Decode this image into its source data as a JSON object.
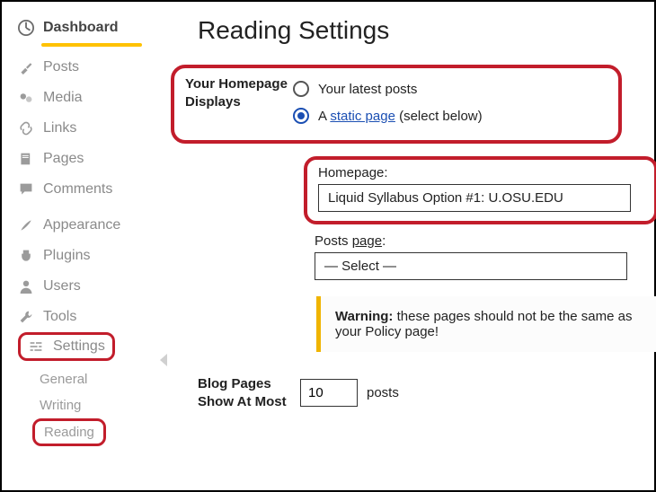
{
  "sidebar": {
    "items": [
      {
        "label": "Dashboard",
        "icon": "dashboard-icon",
        "active": true
      },
      {
        "label": "Posts",
        "icon": "pin-icon"
      },
      {
        "label": "Media",
        "icon": "media-icon"
      },
      {
        "label": "Links",
        "icon": "link-icon"
      },
      {
        "label": "Pages",
        "icon": "page-icon"
      },
      {
        "label": "Comments",
        "icon": "comment-icon"
      },
      {
        "label": "Appearance",
        "icon": "brush-icon"
      },
      {
        "label": "Plugins",
        "icon": "plug-icon"
      },
      {
        "label": "Users",
        "icon": "user-icon"
      },
      {
        "label": "Tools",
        "icon": "wrench-icon"
      },
      {
        "label": "Settings",
        "icon": "settings-icon",
        "highlighted": true
      }
    ],
    "sub_items": [
      {
        "label": "General"
      },
      {
        "label": "Writing"
      },
      {
        "label": "Reading",
        "highlighted": true
      }
    ]
  },
  "page": {
    "title": "Reading Settings",
    "homepage_section_label": "Your Homepage Displays",
    "radio_latest": "Your latest posts",
    "radio_static_prefix": "A ",
    "radio_static_link": "static page",
    "radio_static_suffix": " (select below)",
    "homepage_field_label": "Homepage:",
    "homepage_field_value": "Liquid Syllabus Option #1: U.OSU.EDU",
    "posts_page_label": "Posts page:",
    "posts_page_value": "— Select —",
    "warning_bold": "Warning:",
    "warning_rest": " these pages should not be the same as your Policy page!",
    "blog_pages_label": "Blog Pages Show At Most",
    "blog_pages_value": "10",
    "blog_pages_suffix": "posts"
  }
}
